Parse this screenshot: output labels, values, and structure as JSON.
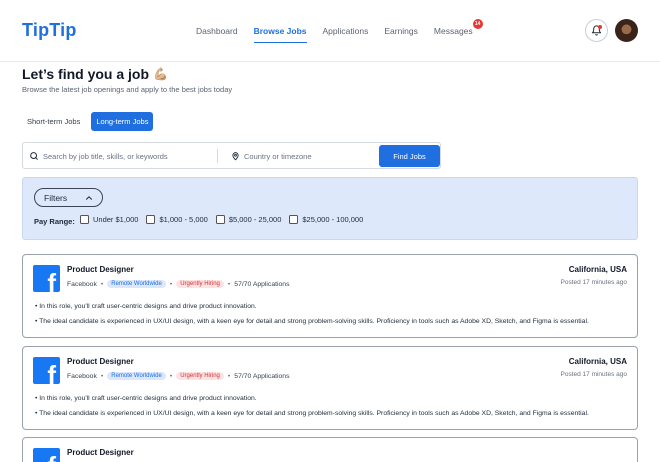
{
  "brand": {
    "name": "TipTip",
    "accent": "#1f6fe0"
  },
  "nav": {
    "items": [
      {
        "label": "Dashboard",
        "active": false
      },
      {
        "label": "Browse Jobs",
        "active": true
      },
      {
        "label": "Applications",
        "active": false
      },
      {
        "label": "Earnings",
        "active": false
      },
      {
        "label": "Messages",
        "active": false,
        "badge": "14"
      }
    ]
  },
  "header": {
    "bell_icon": "bell-icon",
    "avatar": "user-avatar"
  },
  "intro": {
    "title": "Let’s find you a job",
    "emoji": "💪🏼",
    "subtitle": "Browse the latest job openings and apply to the best jobs today"
  },
  "tabs": [
    {
      "label": "Short-term Jobs",
      "active": false
    },
    {
      "label": "Long-term Jobs",
      "active": true
    }
  ],
  "search": {
    "keyword_placeholder": "Search by job title, skills, or keywords",
    "location_placeholder": "Country or timezone",
    "button_label": "Find Jobs"
  },
  "filters": {
    "button_label": "Filters",
    "pay_range_label": "Pay Range:",
    "options": [
      "Under $1,000",
      "$1,000 - 5,000",
      "$5,000 - 25,000",
      "$25,000 - 100,000"
    ]
  },
  "jobs": [
    {
      "title": "Product Designer",
      "company": "Facebook",
      "badge_remote": "Remote Worldwide",
      "badge_urgent": "Urgently Hiring",
      "applications": "57/70 Applications",
      "location": "California, USA",
      "posted": "Posted 17 minutes ago",
      "bullet1": "• In this role, you'll craft user-centric designs and drive product innovation.",
      "bullet2": "• The ideal candidate is experienced in UX/UI design, with a keen eye for detail and strong problem-solving skills. Proficiency in tools such as Adobe XD, Sketch, and Figma is essential."
    },
    {
      "title": "Product Designer",
      "company": "Facebook",
      "badge_remote": "Remote Worldwide",
      "badge_urgent": "Urgently Hiring",
      "applications": "57/70 Applications",
      "location": "California, USA",
      "posted": "Posted 17 minutes ago",
      "bullet1": "• In this role, you'll craft user-centric designs and drive product innovation.",
      "bullet2": "• The ideal candidate is experienced in UX/UI design, with a keen eye for detail and strong problem-solving skills. Proficiency in tools such as Adobe XD, Sketch, and Figma is essential."
    },
    {
      "title": "Product Designer"
    }
  ]
}
